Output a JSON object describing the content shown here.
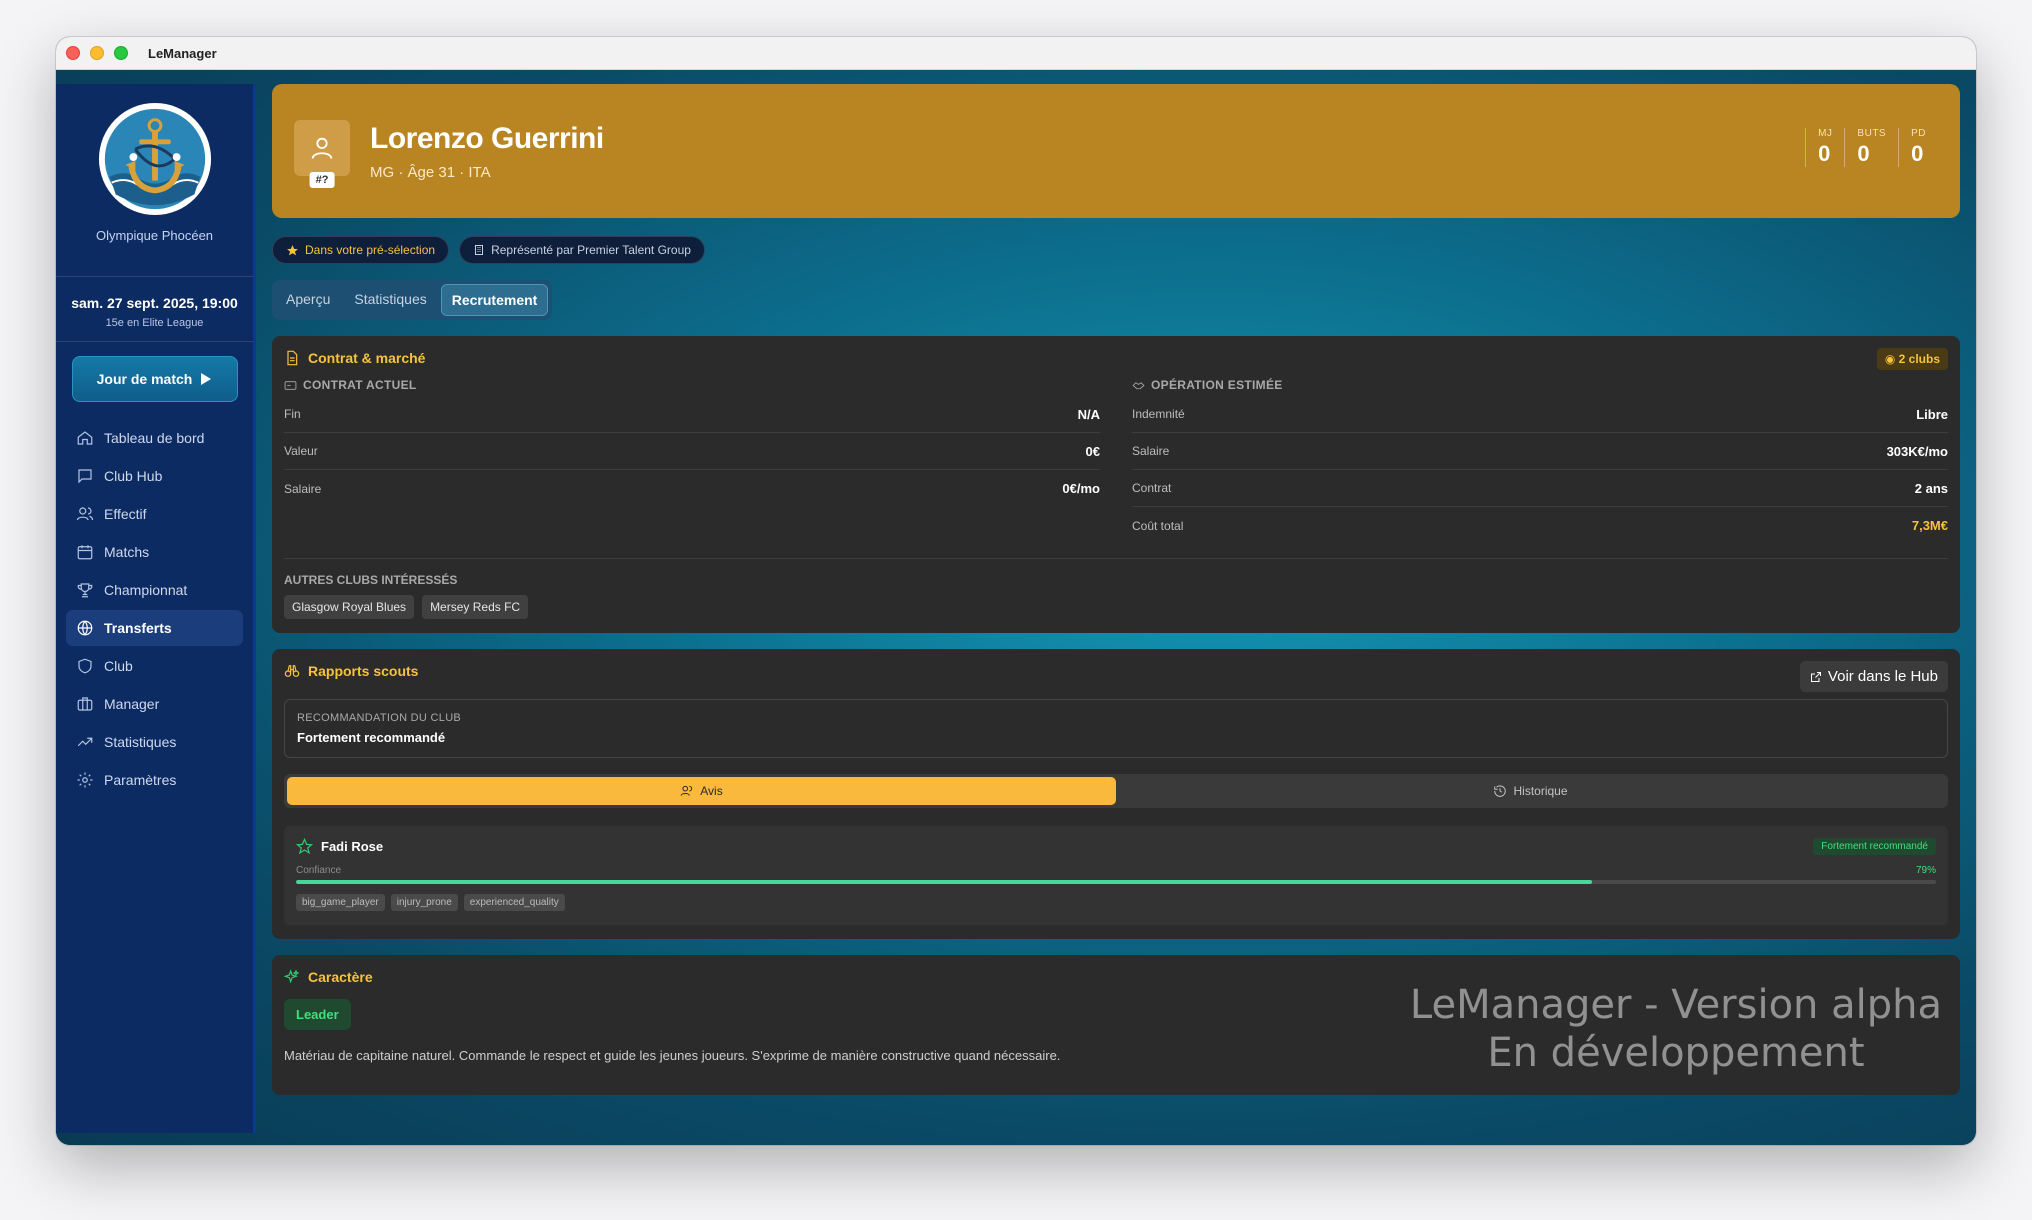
{
  "window": {
    "title": "LeManager"
  },
  "sidebar": {
    "club_name": "Olympique Phocéen",
    "date": "sam. 27 sept. 2025, 19:00",
    "league_position": "15e en Elite League",
    "match_button": "Jour de match",
    "items": [
      {
        "label": "Tableau de bord",
        "icon": "home-icon"
      },
      {
        "label": "Club Hub",
        "icon": "chat-icon"
      },
      {
        "label": "Effectif",
        "icon": "users-icon"
      },
      {
        "label": "Matchs",
        "icon": "calendar-icon"
      },
      {
        "label": "Championnat",
        "icon": "trophy-icon"
      },
      {
        "label": "Transferts",
        "icon": "globe-icon",
        "active": true
      },
      {
        "label": "Club",
        "icon": "shield-icon"
      },
      {
        "label": "Manager",
        "icon": "briefcase-icon"
      },
      {
        "label": "Statistiques",
        "icon": "trend-icon"
      },
      {
        "label": "Paramètres",
        "icon": "gear-icon"
      }
    ]
  },
  "player": {
    "name": "Lorenzo Guerrini",
    "meta": "MG · Âge 31 · ITA",
    "number": "#?",
    "stats": [
      {
        "label": "MJ",
        "value": "0"
      },
      {
        "label": "BUTS",
        "value": "0"
      },
      {
        "label": "PD",
        "value": "0"
      }
    ]
  },
  "pills": {
    "shortlist": "Dans votre pré-sélection",
    "agent": "Représenté par Premier Talent Group"
  },
  "tabs": [
    "Aperçu",
    "Statistiques",
    "Recrutement"
  ],
  "contract": {
    "title": "Contrat & marché",
    "clubs_badge": "2 clubs",
    "current_head": "CONTRAT ACTUEL",
    "current": [
      {
        "label": "Fin",
        "value": "N/A"
      },
      {
        "label": "Valeur",
        "value": "0€"
      },
      {
        "label": "Salaire",
        "value": "0€/mo"
      }
    ],
    "estimate_head": "OPÉRATION ESTIMÉE",
    "estimate": [
      {
        "label": "Indemnité",
        "value": "Libre"
      },
      {
        "label": "Salaire",
        "value": "303K€/mo"
      },
      {
        "label": "Contrat",
        "value": "2 ans"
      },
      {
        "label": "Coût total",
        "value": "7,3M€"
      }
    ],
    "others_label": "AUTRES CLUBS INTÉRESSÉS",
    "others": [
      "Glasgow Royal Blues",
      "Mersey Reds FC"
    ]
  },
  "scouts": {
    "title": "Rapports scouts",
    "hub_button": "Voir dans le Hub",
    "reco_label": "RECOMMANDATION DU CLUB",
    "reco_value": "Fortement recommandé",
    "toggle_avis": "Avis",
    "toggle_hist": "Historique",
    "report": {
      "scout": "Fadi Rose",
      "badge": "Fortement recommandé",
      "conf_label": "Confiance",
      "conf_pct": "79%",
      "conf_value": 0.79,
      "tags": [
        "big_game_player",
        "injury_prone",
        "experienced_quality"
      ]
    }
  },
  "character": {
    "title": "Caractère",
    "trait": "Leader",
    "description": "Matériau de capitaine naturel. Commande le respect et guide les jeunes joueurs. S'exprime de manière constructive quand nécessaire."
  },
  "watermark": {
    "line1": "LeManager - Version alpha",
    "line2": "En développement"
  },
  "colors": {
    "accent": "#f7c33a",
    "hero": "#b98422",
    "sidebar": "#0d2b63",
    "success": "#3ee07e"
  }
}
